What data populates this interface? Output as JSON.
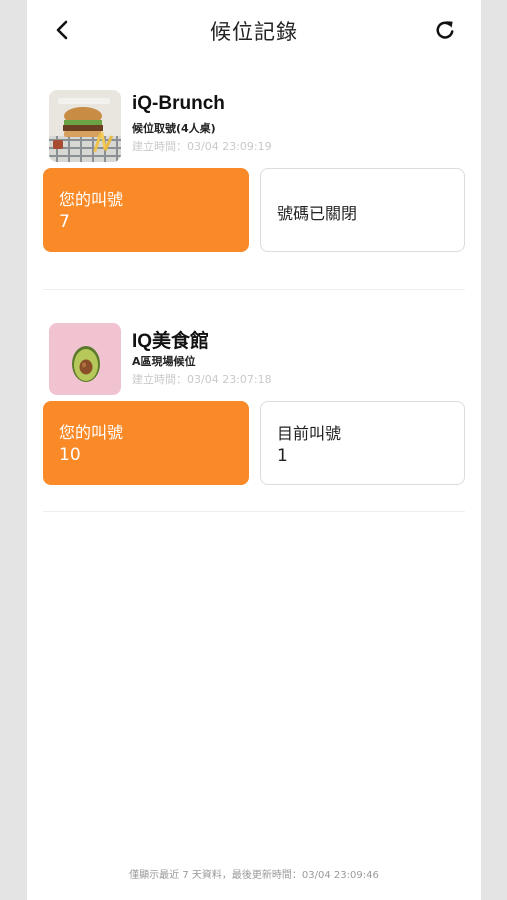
{
  "header": {
    "title": "候位記錄",
    "back_icon": "chevron-left-icon",
    "refresh_icon": "refresh-icon"
  },
  "records": [
    {
      "store_name": "iQ-Brunch",
      "queue_type": "候位取號(4人桌)",
      "created_at": "建立時間：03/04 23:09:19",
      "my_number_label": "您的叫號",
      "my_number": "7",
      "status_text": "號碼已關閉"
    },
    {
      "store_name": "IQ美食館",
      "queue_type": "A區現場候位",
      "created_at": "建立時間：03/04 23:07:18",
      "my_number_label": "您的叫號",
      "my_number": "10",
      "current_label": "目前叫號",
      "current_number": "1"
    }
  ],
  "footer": {
    "note": "僅顯示最近 7 天資料，最後更新時間：03/04 23:09:46"
  },
  "colors": {
    "accent": "#fa8a28",
    "border": "#dcdcdc",
    "muted": "#c9c9c9"
  }
}
